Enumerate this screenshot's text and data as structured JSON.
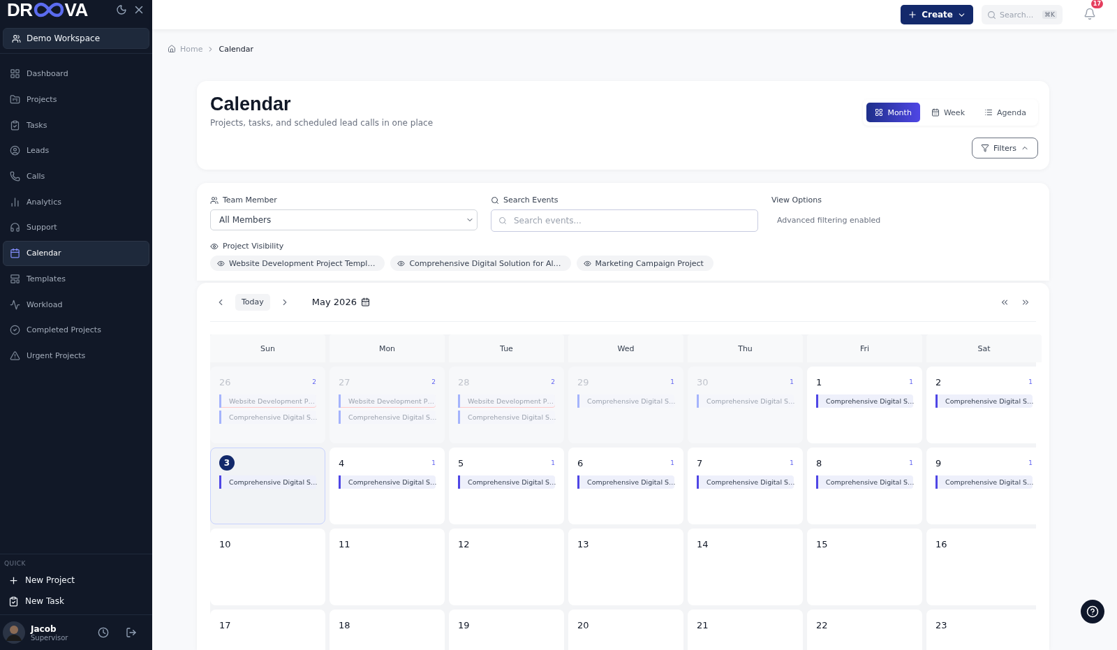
{
  "logo": {
    "prefix": "DR",
    "suffix": "VA"
  },
  "workspace": "Demo Workspace",
  "nav": [
    {
      "label": "Dashboard",
      "selected": false
    },
    {
      "label": "Projects",
      "selected": false
    },
    {
      "label": "Tasks",
      "selected": false
    },
    {
      "label": "Leads",
      "selected": false
    },
    {
      "label": "Calls",
      "selected": false
    },
    {
      "label": "Analytics",
      "selected": false
    },
    {
      "label": "Support",
      "selected": false
    },
    {
      "label": "Calendar",
      "selected": true
    },
    {
      "label": "Templates",
      "selected": false
    },
    {
      "label": "Workload",
      "selected": false
    },
    {
      "label": "Completed Projects",
      "selected": false
    },
    {
      "label": "Urgent Projects",
      "selected": false
    }
  ],
  "quick": {
    "heading": "QUICK",
    "items": [
      "New Project",
      "New Task"
    ]
  },
  "user": {
    "name": "Jacob",
    "role": "Supervisor"
  },
  "topbar": {
    "create": "Create",
    "search_placeholder": "Search...",
    "shortcut": "⌘K",
    "notifications": "17"
  },
  "breadcrumb": [
    "Home",
    "Calendar"
  ],
  "header": {
    "title": "Calendar",
    "subtitle": "Projects, tasks, and scheduled lead calls in one place",
    "views": [
      {
        "label": "Month",
        "selected": true
      },
      {
        "label": "Week",
        "selected": false
      },
      {
        "label": "Agenda",
        "selected": false
      }
    ],
    "filters": "Filters"
  },
  "filters": {
    "team_label": "Team Member",
    "team_value": "All Members",
    "search_label": "Search Events",
    "search_placeholder": "Search events...",
    "view_label": "View Options",
    "view_note": "Advanced filtering enabled",
    "visibility_label": "Project Visibility",
    "projects": [
      "Website Development Project Templ…",
      "Comprehensive Digital Solution for Al…",
      "Marketing Campaign Project"
    ]
  },
  "calendar": {
    "today": "Today",
    "month": "May 2026",
    "weekdays": [
      "Sun",
      "Mon",
      "Tue",
      "Wed",
      "Thu",
      "Fri",
      "Sat"
    ],
    "weeks": [
      [
        {
          "day": "26",
          "muted": true,
          "selected": false,
          "count": "2",
          "events": [
            {
              "title": "Website Development P…",
              "flagged": true
            },
            {
              "title": "Comprehensive Digital S…",
              "flagged": false
            }
          ]
        },
        {
          "day": "27",
          "muted": true,
          "selected": false,
          "count": "2",
          "events": [
            {
              "title": "Website Development P…",
              "flagged": true
            },
            {
              "title": "Comprehensive Digital S…",
              "flagged": false
            }
          ]
        },
        {
          "day": "28",
          "muted": true,
          "selected": false,
          "count": "2",
          "events": [
            {
              "title": "Website Development P…",
              "flagged": true
            },
            {
              "title": "Comprehensive Digital S…",
              "flagged": false
            }
          ]
        },
        {
          "day": "29",
          "muted": true,
          "selected": false,
          "count": "1",
          "events": [
            {
              "title": "Comprehensive Digital S…",
              "flagged": false
            }
          ]
        },
        {
          "day": "30",
          "muted": true,
          "selected": false,
          "count": "1",
          "events": [
            {
              "title": "Comprehensive Digital S…",
              "flagged": false
            }
          ]
        },
        {
          "day": "1",
          "muted": false,
          "selected": false,
          "count": "1",
          "events": [
            {
              "title": "Comprehensive Digital S…",
              "flagged": false
            }
          ]
        },
        {
          "day": "2",
          "muted": false,
          "selected": false,
          "count": "1",
          "events": [
            {
              "title": "Comprehensive Digital S…",
              "flagged": false
            }
          ]
        }
      ],
      [
        {
          "day": "3",
          "muted": false,
          "selected": true,
          "events": [
            {
              "title": "Comprehensive Digital S…",
              "flagged": false
            }
          ]
        },
        {
          "day": "4",
          "muted": false,
          "selected": false,
          "count": "1",
          "events": [
            {
              "title": "Comprehensive Digital S…",
              "flagged": false
            }
          ]
        },
        {
          "day": "5",
          "muted": false,
          "selected": false,
          "count": "1",
          "events": [
            {
              "title": "Comprehensive Digital S…",
              "flagged": false
            }
          ]
        },
        {
          "day": "6",
          "muted": false,
          "selected": false,
          "count": "1",
          "events": [
            {
              "title": "Comprehensive Digital S…",
              "flagged": false
            }
          ]
        },
        {
          "day": "7",
          "muted": false,
          "selected": false,
          "count": "1",
          "events": [
            {
              "title": "Comprehensive Digital S…",
              "flagged": false
            }
          ]
        },
        {
          "day": "8",
          "muted": false,
          "selected": false,
          "count": "1",
          "events": [
            {
              "title": "Comprehensive Digital S…",
              "flagged": false
            }
          ]
        },
        {
          "day": "9",
          "muted": false,
          "selected": false,
          "count": "1",
          "events": [
            {
              "title": "Comprehensive Digital S…",
              "flagged": false
            }
          ]
        }
      ],
      [
        {
          "day": "10",
          "muted": false,
          "selected": false
        },
        {
          "day": "11",
          "muted": false,
          "selected": false
        },
        {
          "day": "12",
          "muted": false,
          "selected": false
        },
        {
          "day": "13",
          "muted": false,
          "selected": false
        },
        {
          "day": "14",
          "muted": false,
          "selected": false
        },
        {
          "day": "15",
          "muted": false,
          "selected": false
        },
        {
          "day": "16",
          "muted": false,
          "selected": false
        }
      ],
      [
        {
          "day": "17",
          "muted": false,
          "selected": false
        },
        {
          "day": "18",
          "muted": false,
          "selected": false
        },
        {
          "day": "19",
          "muted": false,
          "selected": false
        },
        {
          "day": "20",
          "muted": false,
          "selected": false
        },
        {
          "day": "21",
          "muted": false,
          "selected": false
        },
        {
          "day": "22",
          "muted": false,
          "selected": false
        },
        {
          "day": "23",
          "muted": false,
          "selected": false
        }
      ]
    ]
  }
}
